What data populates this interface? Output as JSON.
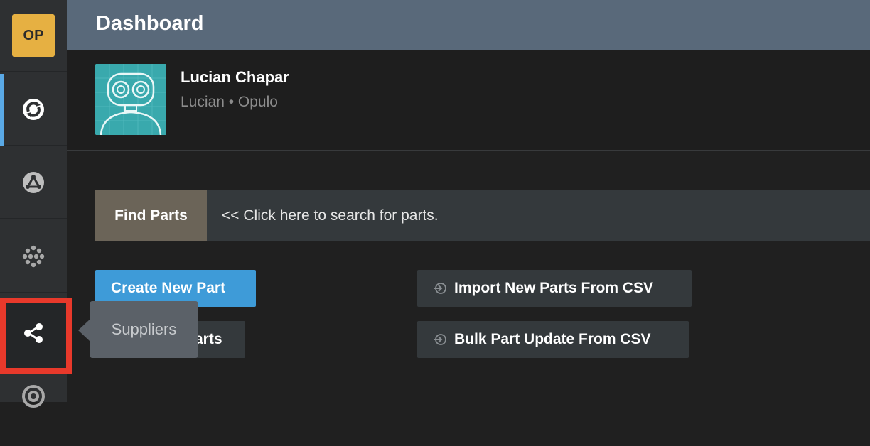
{
  "sidebar": {
    "logo_text": "OP",
    "items": [
      {
        "icon": "refresh-circle-icon"
      },
      {
        "icon": "circle-triangle-icon"
      },
      {
        "icon": "dots-grid-icon"
      },
      {
        "icon": "share-icon"
      },
      {
        "icon": "target-icon"
      }
    ]
  },
  "header": {
    "title": "Dashboard"
  },
  "profile": {
    "name": "Lucian Chapar",
    "subtitle": "Lucian • Opulo"
  },
  "search": {
    "button_label": "Find Parts",
    "hint": "<< Click here to search for parts."
  },
  "actions": {
    "create_label": "Create New Part",
    "parts_label_visible": "arts",
    "import_label": "Import New Parts From CSV",
    "bulk_label": "Bulk Part Update From CSV"
  },
  "tooltip": {
    "text": "Suppliers"
  },
  "colors": {
    "accent": "#3e9bd8",
    "logo": "#e6b042",
    "highlight": "#e8392b",
    "header": "#59697a"
  }
}
